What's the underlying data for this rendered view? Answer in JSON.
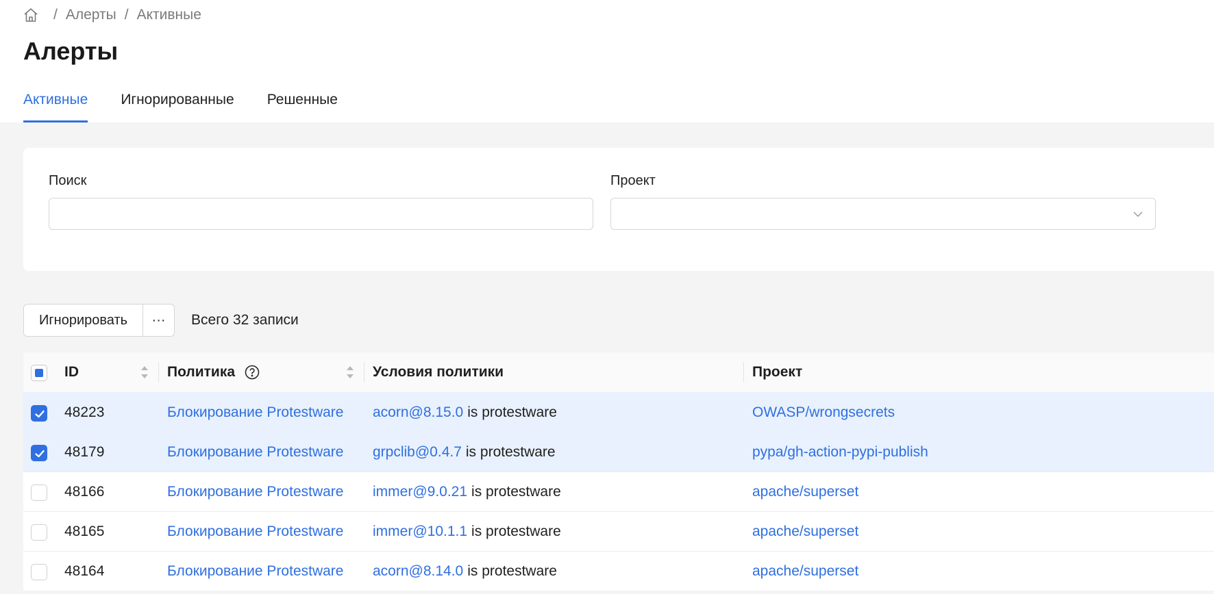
{
  "breadcrumb": {
    "home_icon": "home-icon",
    "items": [
      "Алерты",
      "Активные"
    ],
    "separator": "/"
  },
  "page": {
    "title": "Алерты"
  },
  "tabs": [
    {
      "label": "Активные",
      "active": true
    },
    {
      "label": "Игнорированные",
      "active": false
    },
    {
      "label": "Решенные",
      "active": false
    }
  ],
  "filters": {
    "search_label": "Поиск",
    "search_value": "",
    "project_label": "Проект",
    "project_value": ""
  },
  "toolbar": {
    "ignore_label": "Игнорировать",
    "more_label": "···",
    "total_label": "Всего 32 записи"
  },
  "table": {
    "columns": [
      "ID",
      "Политика",
      "Условия политики",
      "Проект"
    ],
    "rows": [
      {
        "selected": true,
        "id": "48223",
        "policy": "Блокирование Protestware",
        "package": "acorn@8.15.0",
        "condition_suffix": "is protestware",
        "project": "OWASP/wrongsecrets"
      },
      {
        "selected": true,
        "id": "48179",
        "policy": "Блокирование Protestware",
        "package": "grpclib@0.4.7",
        "condition_suffix": "is protestware",
        "project": "pypa/gh-action-pypi-publish"
      },
      {
        "selected": false,
        "id": "48166",
        "policy": "Блокирование Protestware",
        "package": "immer@9.0.21",
        "condition_suffix": "is protestware",
        "project": "apache/superset"
      },
      {
        "selected": false,
        "id": "48165",
        "policy": "Блокирование Protestware",
        "package": "immer@10.1.1",
        "condition_suffix": "is protestware",
        "project": "apache/superset"
      },
      {
        "selected": false,
        "id": "48164",
        "policy": "Блокирование Protestware",
        "package": "acorn@8.14.0",
        "condition_suffix": "is protestware",
        "project": "apache/superset"
      }
    ]
  },
  "colors": {
    "accent": "#2f6fe0",
    "selected_row": "#e8f1fd",
    "page_bg": "#f4f4f4"
  }
}
